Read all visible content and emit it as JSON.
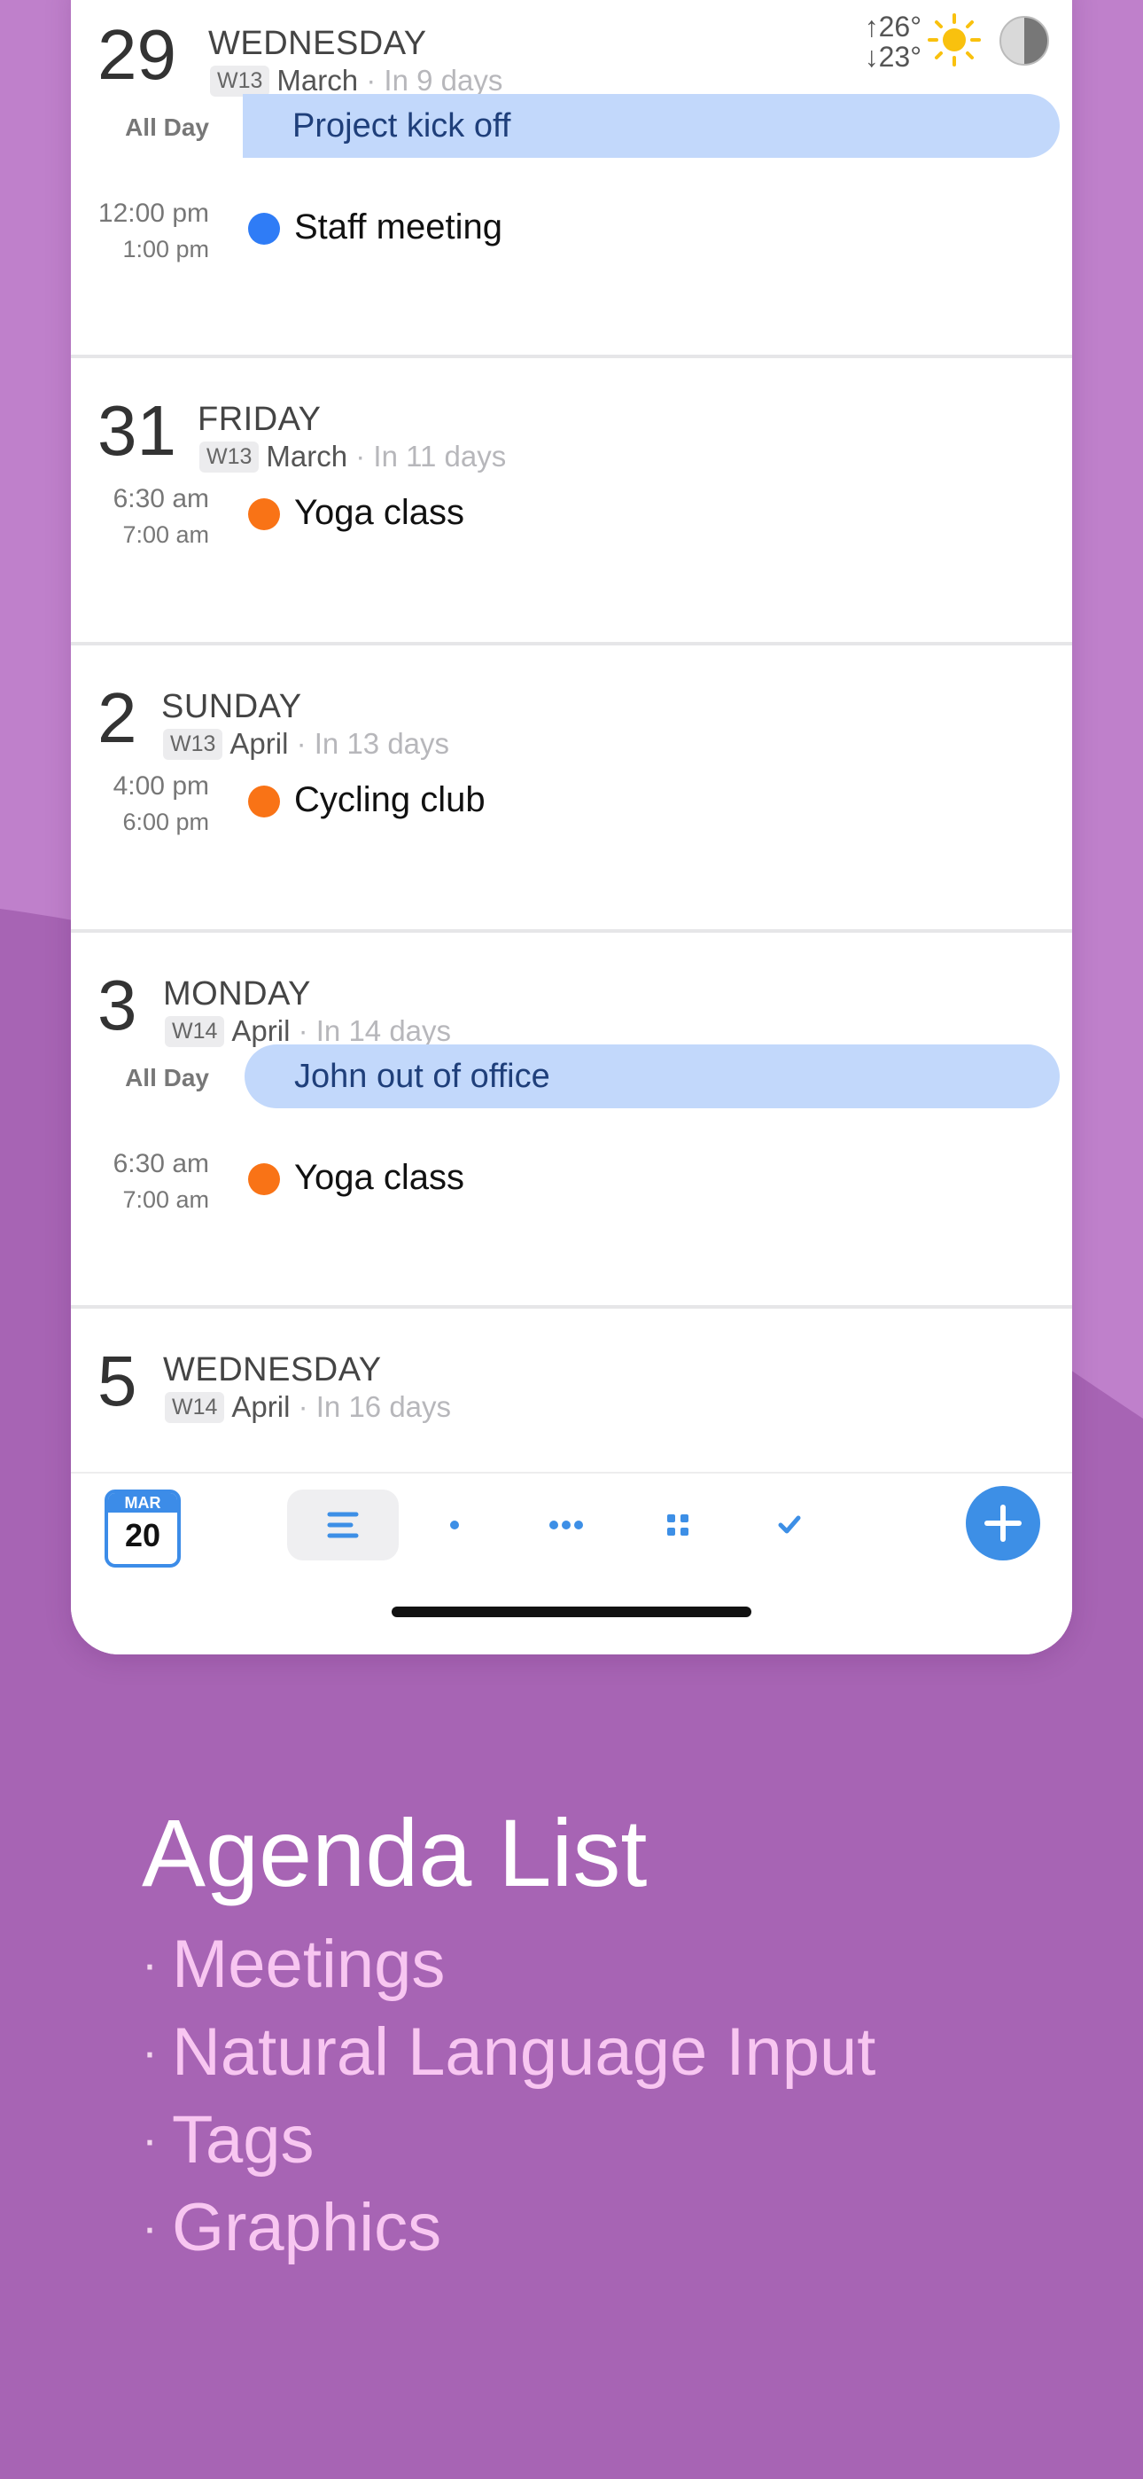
{
  "weather": {
    "high": "↑26°",
    "low": "↓23°",
    "sun_icon": "sun-icon",
    "moon_icon": "moon-phase-icon"
  },
  "days": [
    {
      "number": "29",
      "weekday": "WEDNESDAY",
      "week": "W13",
      "month": "March",
      "relative": "· In 9 days",
      "allday": {
        "label": "All Day",
        "title": "Project kick off"
      },
      "events": [
        {
          "start": "12:00 pm",
          "end": "1:00 pm",
          "title": "Staff meeting",
          "color": "#2f7cf6"
        }
      ]
    },
    {
      "number": "31",
      "weekday": "FRIDAY",
      "week": "W13",
      "month": "March",
      "relative": "· In 11 days",
      "events": [
        {
          "start": "6:30 am",
          "end": "7:00 am",
          "title": "Yoga class",
          "color": "#f97316"
        }
      ]
    },
    {
      "number": "2",
      "weekday": "SUNDAY",
      "week": "W13",
      "month": "April",
      "relative": "· In 13 days",
      "events": [
        {
          "start": "4:00 pm",
          "end": "6:00 pm",
          "title": "Cycling club",
          "color": "#f97316"
        }
      ]
    },
    {
      "number": "3",
      "weekday": "MONDAY",
      "week": "W14",
      "month": "April",
      "relative": "· In 14 days",
      "allday": {
        "label": "All Day",
        "title": "John out of office"
      },
      "events": [
        {
          "start": "6:30 am",
          "end": "7:00 am",
          "title": "Yoga class",
          "color": "#f97316"
        }
      ]
    },
    {
      "number": "5",
      "weekday": "WEDNESDAY",
      "week": "W14",
      "month": "April",
      "relative": "· In 16 days"
    }
  ],
  "toolbar": {
    "today_month": "MAR",
    "today_day": "20",
    "views": [
      "agenda",
      "day",
      "three-day",
      "month",
      "tasks"
    ],
    "active_view": "agenda",
    "add_icon": "plus-icon"
  },
  "promo": {
    "title": "Agenda List",
    "bullet": "·",
    "items": [
      "Meetings",
      "Natural Language Input",
      "Tags",
      "Graphics"
    ]
  },
  "colors": {
    "background_light": "#bf80cb",
    "background_dark": "#a764b4",
    "accent_blue": "#3d8fe6",
    "allday_fill": "#c2d8fb",
    "promo_item_text": "#f8c6f1"
  }
}
